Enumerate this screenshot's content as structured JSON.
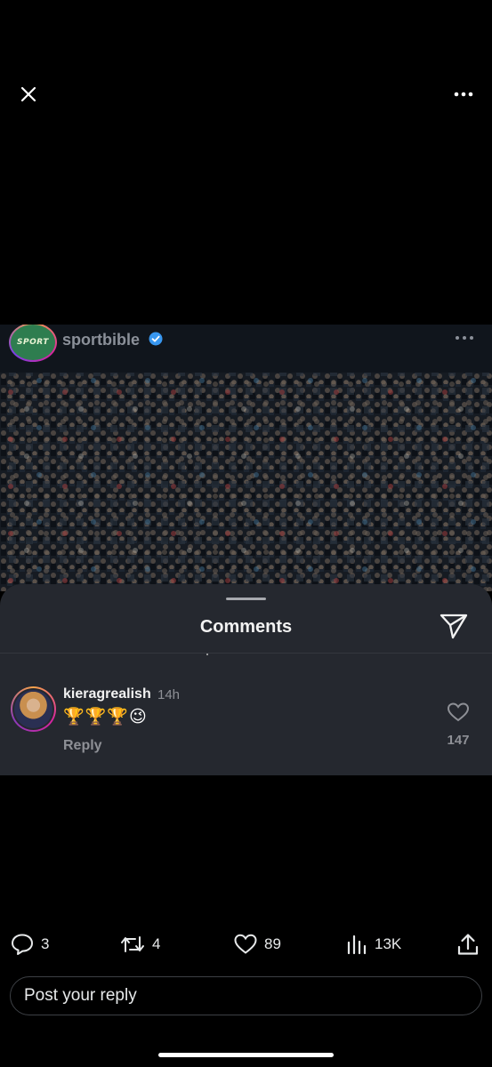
{
  "top_bar": {
    "close_icon": "close-icon",
    "more_icon": "more-horizontal-icon"
  },
  "post": {
    "avatar_text": "SPORT",
    "username": "sportbible",
    "verified_color": "#3897f0"
  },
  "comments_sheet": {
    "title": "Comments",
    "send_icon": "paper-plane-icon",
    "comment": {
      "username": "kieragrealish",
      "time": "14h",
      "text": "🏆🏆🏆😉",
      "reply_label": "Reply",
      "like_count": "147"
    }
  },
  "actions": {
    "replies": "3",
    "reposts": "4",
    "likes": "89",
    "views": "13K"
  },
  "reply_input": {
    "placeholder": "Post your reply"
  },
  "colors": {
    "background": "#000000",
    "sheet": "#25282f",
    "muted": "#8e9096"
  }
}
